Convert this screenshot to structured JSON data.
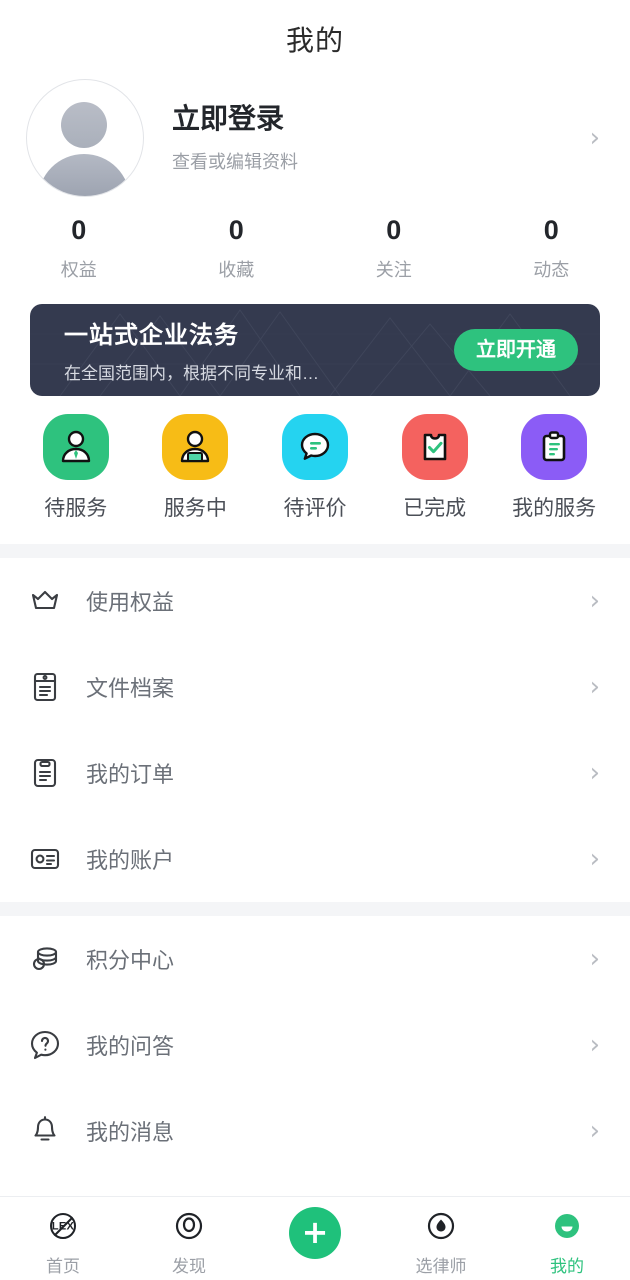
{
  "header": {
    "title": "我的"
  },
  "profile": {
    "name": "立即登录",
    "subtitle": "查看或编辑资料",
    "avatar_icon": "default-avatar-person-icon",
    "chevron": "›"
  },
  "stats": [
    {
      "value": "0",
      "label": "权益"
    },
    {
      "value": "0",
      "label": "收藏"
    },
    {
      "value": "0",
      "label": "关注"
    },
    {
      "value": "0",
      "label": "动态"
    }
  ],
  "banner": {
    "title": "一站式企业法务",
    "subtitle": "在全国范围内，根据不同专业和…",
    "button_label": "立即开通",
    "bg_color": "#343a4f",
    "button_color": "#2ec27e"
  },
  "services": [
    {
      "label": "待服务",
      "icon": "person-tie-icon",
      "color": "#2ec27e"
    },
    {
      "label": "服务中",
      "icon": "person-desk-icon",
      "color": "#f7bc16"
    },
    {
      "label": "待评价",
      "icon": "chat-bubble-icon",
      "color": "#25d3f0"
    },
    {
      "label": "已完成",
      "icon": "clipboard-check-icon",
      "color": "#f4625f"
    },
    {
      "label": "我的服务",
      "icon": "clipboard-lines-icon",
      "color": "#8b5cf6"
    }
  ],
  "menu_groups": [
    {
      "items": [
        {
          "label": "使用权益",
          "icon": "crown-icon",
          "chevron": "›"
        },
        {
          "label": "文件档案",
          "icon": "file-archive-icon",
          "chevron": "›"
        },
        {
          "label": "我的订单",
          "icon": "order-list-icon",
          "chevron": "›"
        },
        {
          "label": "我的账户",
          "icon": "id-card-icon",
          "chevron": "›"
        }
      ]
    },
    {
      "items": [
        {
          "label": "积分中心",
          "icon": "coins-icon",
          "chevron": "›"
        },
        {
          "label": "我的问答",
          "icon": "question-bubble-icon",
          "chevron": "›"
        },
        {
          "label": "我的消息",
          "icon": "bell-icon",
          "chevron": "›"
        }
      ]
    }
  ],
  "tabbar": {
    "items": [
      {
        "label": "首页",
        "icon": "lex-home-icon",
        "active": false,
        "badge_text": "LEX"
      },
      {
        "label": "发现",
        "icon": "discover-ring-icon",
        "active": false
      },
      {
        "label": "",
        "icon": "plus-fab-icon",
        "active": false
      },
      {
        "label": "选律师",
        "icon": "droplet-circle-icon",
        "active": false
      },
      {
        "label": "我的",
        "icon": "profile-face-icon",
        "active": true
      }
    ],
    "active_color": "#2ec27e",
    "fab_color": "#1fc17b",
    "plus_glyph": "+"
  }
}
